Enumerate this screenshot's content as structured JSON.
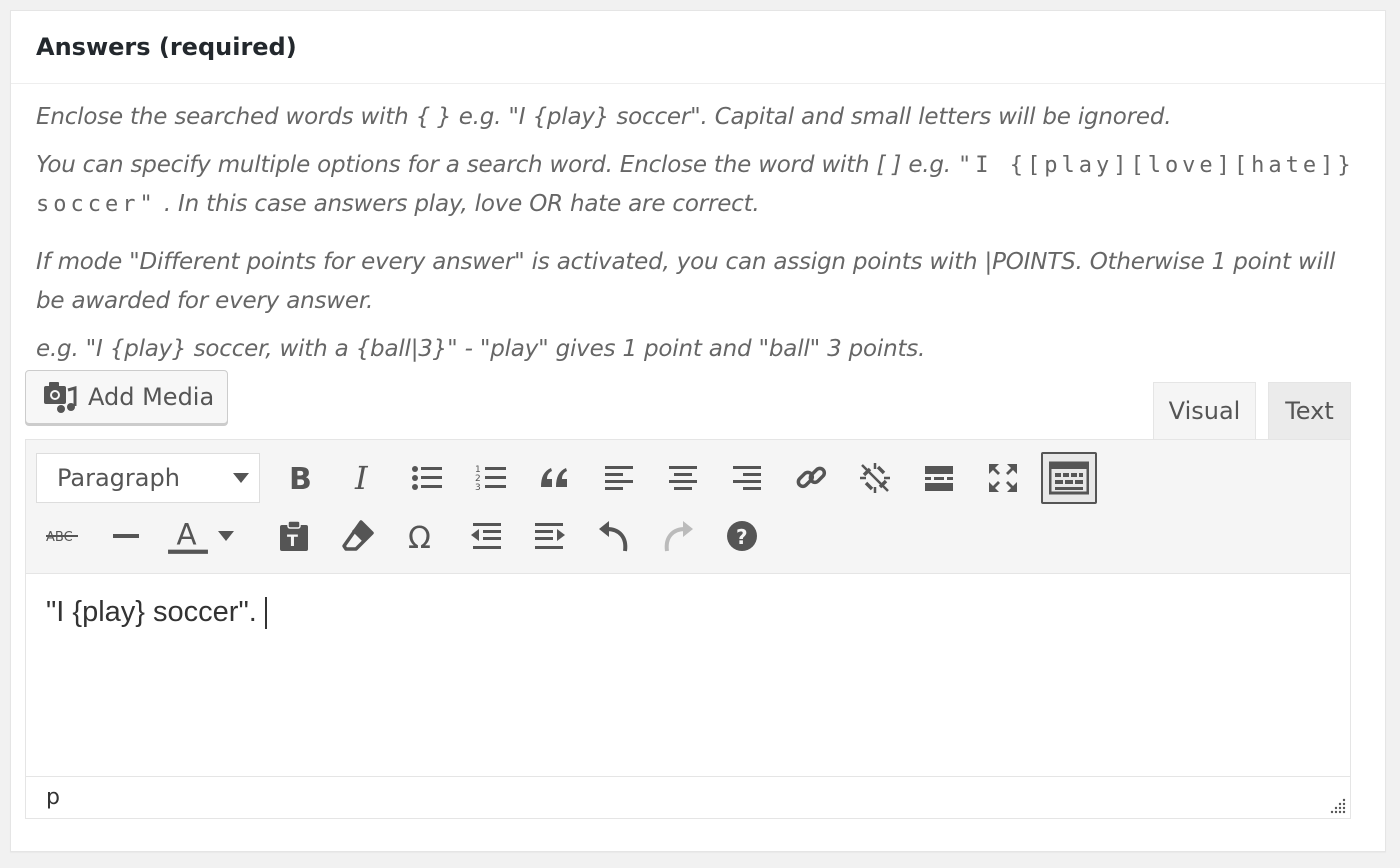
{
  "box": {
    "title": "Answers (required)"
  },
  "description": {
    "line1": "Enclose the searched words with { } e.g. \"I {play} soccer\". Capital and small letters will be ignored.",
    "line2_pre": "You can specify multiple options for a search word. Enclose the word with [ ] e.g. ",
    "line2_code": "\"I {[play][love][hate]} soccer\"",
    "line2_post": " . In this case answers play, love OR hate are correct.",
    "line3": "If mode \"Different points for every answer\" is activated, you can assign points with |POINTS. Otherwise 1 point will be awarded for every answer.",
    "line4": "e.g. \"I {play} soccer, with a {ball|3}\" - \"play\" gives 1 point and \"ball\" 3 points."
  },
  "editor": {
    "add_media_label": "Add Media",
    "tabs": [
      {
        "label": "Visual",
        "active": true
      },
      {
        "label": "Text",
        "active": false
      }
    ],
    "format_select_value": "Paragraph",
    "content_text": "\"I {play} soccer\".",
    "status_path": "p",
    "toolbar_row1": [
      "bold-icon",
      "italic-icon",
      "bullet-list-icon",
      "numbered-list-icon",
      "blockquote-icon",
      "align-left-icon",
      "align-center-icon",
      "align-right-icon",
      "link-icon",
      "unlink-icon",
      "read-more-icon",
      "fullscreen-icon",
      "toolbar-toggle-icon"
    ],
    "toolbar_row2": [
      "strikethrough-icon",
      "horizontal-line-icon",
      "text-color-icon",
      "paste-text-icon",
      "clear-formatting-icon",
      "special-character-icon",
      "outdent-icon",
      "indent-icon",
      "undo-icon",
      "redo-icon",
      "help-icon"
    ],
    "colors": {
      "icon": "#555555",
      "disabled_icon": "#bbbbbb",
      "toolbar_bg": "#f5f5f5"
    }
  }
}
